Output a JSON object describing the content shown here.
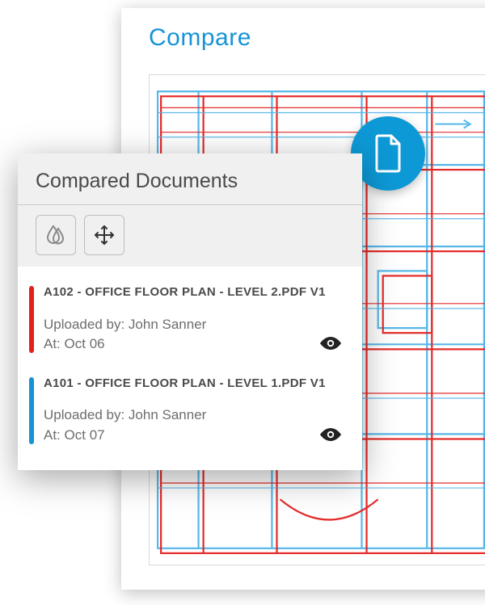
{
  "colors": {
    "accent": "#1693d6",
    "red": "#e32020",
    "blue": "#1693d6"
  },
  "viewer": {
    "title": "Compare"
  },
  "fab": {
    "icon": "document-icon"
  },
  "panel": {
    "title": "Compared Documents",
    "tools": {
      "opacity": "opacity-icon",
      "move": "move-icon"
    }
  },
  "documents": [
    {
      "stripe": "red",
      "title": "A102 - OFFICE FLOOR PLAN - LEVEL 2.PDF V1",
      "uploaded_by_label": "Uploaded by:",
      "uploaded_by": "John Sanner",
      "at_label": "At:",
      "at": "Oct 06"
    },
    {
      "stripe": "blue",
      "title": "A101 - OFFICE FLOOR PLAN - LEVEL 1.PDF V1",
      "uploaded_by_label": "Uploaded by:",
      "uploaded_by": "John Sanner",
      "at_label": "At:",
      "at": "Oct 07"
    }
  ]
}
